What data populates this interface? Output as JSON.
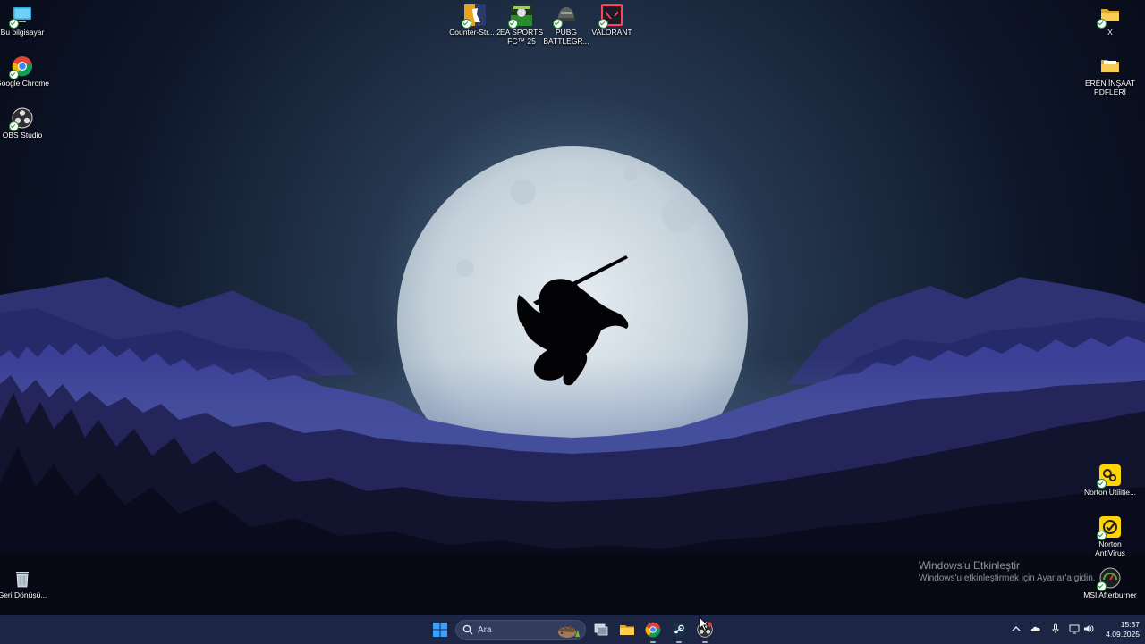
{
  "desktop": {
    "left_icons": [
      {
        "label": "Bu bilgisayar",
        "icon": "computer-icon"
      },
      {
        "label": "Google Chrome",
        "icon": "chrome-icon"
      },
      {
        "label": "OBS Studio",
        "icon": "obs-icon"
      }
    ],
    "top_icons": [
      {
        "label": "Counter-Str... 2",
        "icon": "counter-strike-icon"
      },
      {
        "label": "EA SPORTS FC™ 25",
        "icon": "ea-sports-fc-icon"
      },
      {
        "label": "PUBG BATTLEGR...",
        "icon": "pubg-icon"
      },
      {
        "label": "VALORANT",
        "icon": "valorant-icon"
      }
    ],
    "right_icons": [
      {
        "label": "X",
        "icon": "folder-icon"
      },
      {
        "label": "EREN İNŞAAT PDFLERİ",
        "icon": "folder-icon"
      },
      {
        "label": "Norton Utilitie...",
        "icon": "norton-utilities-icon"
      },
      {
        "label": "Norton AntiVirus",
        "icon": "norton-antivirus-icon"
      },
      {
        "label": "MSI Afterburner",
        "icon": "msi-afterburner-icon"
      }
    ],
    "recycle_bin": {
      "label": "Geri Dönüşü...",
      "icon": "recycle-bin-icon"
    }
  },
  "activation": {
    "title": "Windows'u Etkinleştir",
    "subtitle": "Windows'u etkinleştirmek için Ayarlar'a gidin."
  },
  "taskbar": {
    "search_placeholder": "Ara",
    "apps": [
      "start-icon",
      "task-view-icon",
      "file-explorer-icon",
      "chrome-icon",
      "steam-icon",
      "obs-icon"
    ],
    "tray": [
      "chevron-up-icon",
      "onedrive-icon",
      "microphone-icon",
      "network-icon",
      "volume-icon"
    ],
    "time": "15:37",
    "date": "4.09.2025"
  },
  "colors": {
    "taskbar_bg": "#1c2644",
    "sky_top": "#0b1326",
    "moon": "#c8d4de",
    "mountains": "#33367e"
  }
}
